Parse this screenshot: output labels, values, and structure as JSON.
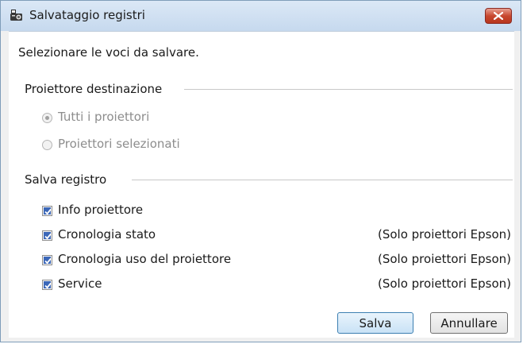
{
  "window": {
    "title": "Salvataggio registri",
    "close_icon": "close-icon"
  },
  "instructions": "Selezionare le voci da salvare.",
  "destination_group": {
    "label": "Proiettore destinazione",
    "options": [
      {
        "label": "Tutti i proiettori",
        "selected": true,
        "enabled": false
      },
      {
        "label": "Proiettori selezionati",
        "selected": false,
        "enabled": false
      }
    ]
  },
  "log_group": {
    "label": "Salva registro",
    "items": [
      {
        "label": "Info proiettore",
        "checked": true,
        "note": ""
      },
      {
        "label": "Cronologia stato",
        "checked": true,
        "note": "(Solo proiettori Epson)"
      },
      {
        "label": "Cronologia uso del proiettore",
        "checked": true,
        "note": "(Solo proiettori Epson)"
      },
      {
        "label": "Service",
        "checked": true,
        "note": "(Solo proiettori Epson)"
      }
    ]
  },
  "buttons": {
    "save": "Salva",
    "cancel": "Annullare"
  },
  "colors": {
    "title_gradient_top": "#dbe8f6",
    "close_red": "#c8482f",
    "checkbox_blue": "#3b67b8"
  }
}
